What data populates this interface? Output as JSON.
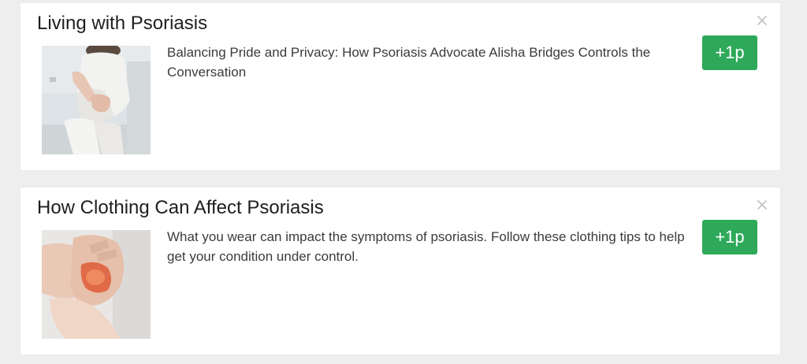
{
  "cards": [
    {
      "title": "Living with Psoriasis",
      "description": "Balancing Pride and Privacy: How Psoriasis Advocate Alisha Bridges Controls the Conversation",
      "points_label": "+1p",
      "thumbnail_icon": "woman-sitting-photo",
      "close_icon": "close-icon"
    },
    {
      "title": "How Clothing Can Affect Psoriasis",
      "description": "What you wear can impact the symptoms of psoriasis. Follow these clothing tips to help get your condition under control.",
      "points_label": "+1p",
      "thumbnail_icon": "scratching-hands-photo",
      "close_icon": "close-icon"
    }
  ],
  "colors": {
    "accent_button": "#2ea95a",
    "background": "#eeeeef",
    "card": "#ffffff"
  }
}
